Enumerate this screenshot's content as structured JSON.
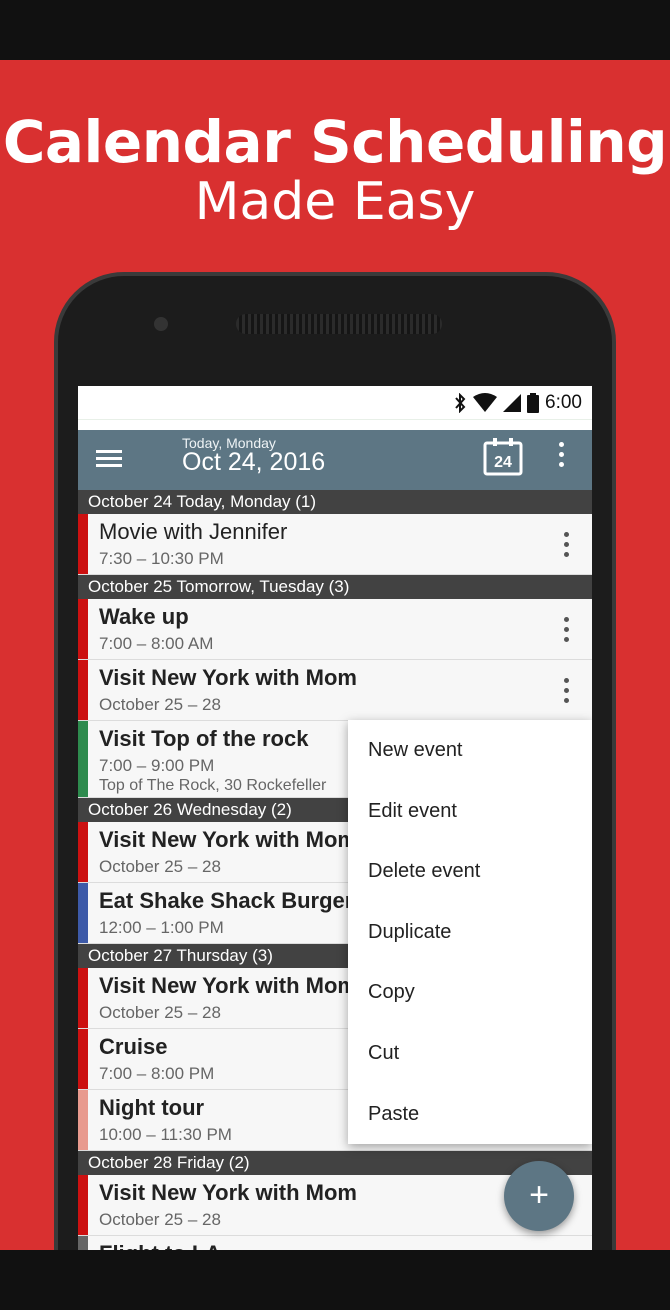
{
  "promo": {
    "headline": "Calendar Scheduling",
    "subline": "Made Easy"
  },
  "status_bar": {
    "time": "6:00",
    "icons": [
      "bluetooth-icon",
      "wifi-icon",
      "signal-icon",
      "battery-icon"
    ]
  },
  "app_bar": {
    "date_small": "Today, Monday",
    "date_big": "Oct 24, 2016",
    "today_badge": "24",
    "menu_icon": "hamburger-menu-icon",
    "overflow_icon": "more-vert-icon"
  },
  "sections": [
    {
      "header": "October 24 Today, Monday (1)",
      "events": [
        {
          "title": "Movie with Jennifer",
          "time": "7:30 – 10:30 PM",
          "color": "#cc1111",
          "bold": false
        }
      ]
    },
    {
      "header": "October 25 Tomorrow, Tuesday (3)",
      "events": [
        {
          "title": "Wake up",
          "time": "7:00 – 8:00 AM",
          "color": "#cc1111",
          "bold": true
        },
        {
          "title": "Visit New York with Mom",
          "time": "October 25 – 28",
          "color": "#cc1111",
          "bold": true
        },
        {
          "title": "Visit Top of the rock",
          "time": "7:00 – 9:00 PM",
          "location": "Top of The Rock, 30 Rockefeller",
          "color": "#2e8b4e",
          "bold": true
        }
      ]
    },
    {
      "header": "October 26 Wednesday (2)",
      "events": [
        {
          "title": "Visit New York with Mom",
          "time": "October 25 – 28",
          "color": "#cc1111",
          "bold": true
        },
        {
          "title": "Eat Shake Shack Burger",
          "time": "12:00 – 1:00 PM",
          "color": "#3d5aa8",
          "bold": true
        }
      ]
    },
    {
      "header": "October 27 Thursday (3)",
      "events": [
        {
          "title": "Visit New York with Mom",
          "time": "October 25 – 28",
          "color": "#cc1111",
          "bold": true
        },
        {
          "title": "Cruise",
          "time": "7:00 – 8:00 PM",
          "color": "#cc1111",
          "bold": true
        },
        {
          "title": "Night tour",
          "time": "10:00 – 11:30 PM",
          "color": "#e89a8e",
          "bold": true
        }
      ]
    },
    {
      "header": "October 28 Friday (2)",
      "events": [
        {
          "title": "Visit New York with Mom",
          "time": "October 25 – 28",
          "color": "#cc1111",
          "bold": true
        },
        {
          "title": "Flight to LA",
          "time": "",
          "color": "#666666",
          "bold": true
        }
      ]
    }
  ],
  "context_menu": {
    "items": [
      "New event",
      "Edit event",
      "Delete event",
      "Duplicate",
      "Copy",
      "Cut",
      "Paste"
    ]
  },
  "fab": {
    "label": "+",
    "icon": "add-icon"
  },
  "colors": {
    "background": "#d93030",
    "app_bar": "#5d7684",
    "section_header": "#424242"
  }
}
